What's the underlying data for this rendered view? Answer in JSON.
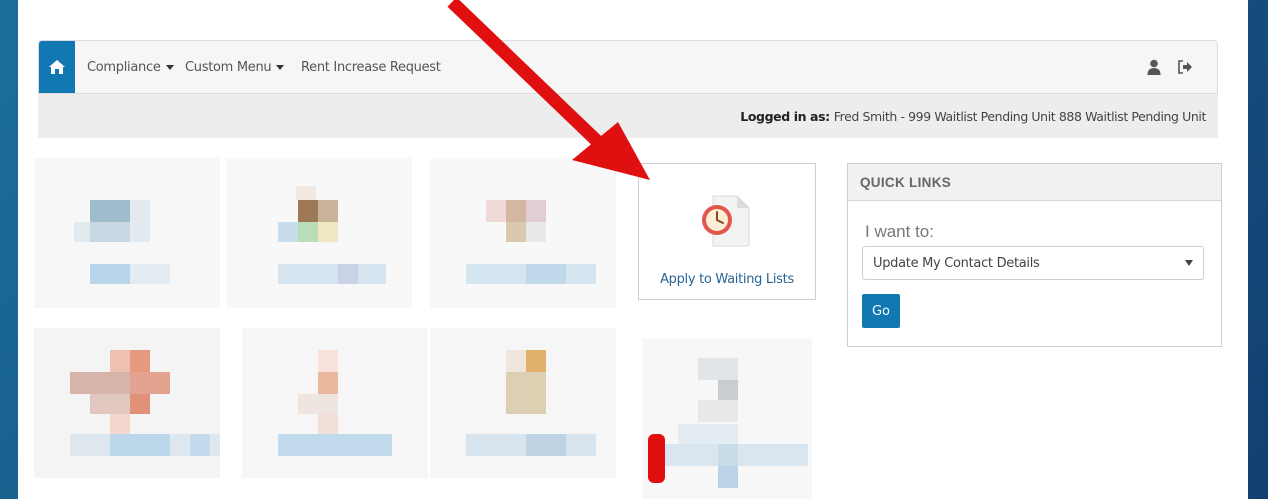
{
  "navbar": {
    "items": [
      {
        "label": "Compliance",
        "dropdown": true
      },
      {
        "label": "Custom Menu",
        "dropdown": true
      },
      {
        "label": "Rent Increase Request",
        "dropdown": false
      }
    ],
    "icons": [
      "home-icon",
      "user-icon",
      "logout-icon"
    ]
  },
  "subbar": {
    "logged_in_prefix": "Logged in as:",
    "logged_in_user": "Fred Smith - 999 Waitlist Pending Unit 888 Waitlist Pending Unit"
  },
  "waiting_list_tile": {
    "label": "Apply to Waiting Lists",
    "icon": "clock-document-icon"
  },
  "quick_links": {
    "title": "QUICK LINKS",
    "prompt": "I want to:",
    "selected": "Update My Contact Details",
    "go_label": "Go"
  },
  "colors": {
    "accent": "#1178b4",
    "link": "#2a6496",
    "annotation": "#e01010",
    "background": "#175d8a"
  }
}
